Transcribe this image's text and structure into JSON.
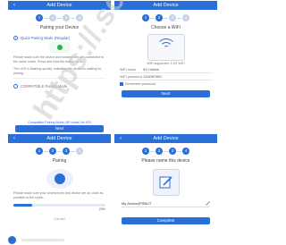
{
  "header_title": "Add Device",
  "steps": [
    "1",
    "2",
    "3",
    "4"
  ],
  "panel1": {
    "subtitle": "Pairing your Device",
    "option1": "Quick Pairing Mode (Regular)",
    "desc1": "Please make sure the device and smartphone are connected to the same router. Press and hold the button for 5s.",
    "desc2": "The LED is flashing quickly, indicating the device is waiting for pairing.",
    "option2": "COMPATIBLE Pairing Mode",
    "link": "Compatible Pairing Mode (AP mode) for iOS",
    "button": "Next"
  },
  "panel2": {
    "subtitle": "Choose a WiFi",
    "caption": "WiFi supported: 2.4G WiFi",
    "wifi_name_label": "WiFi name",
    "wifi_name_value": "5G Hotline",
    "wifi_pw_label": "WiFi password",
    "wifi_pw_value": "1234567891",
    "remember": "Remember password",
    "button": "Next"
  },
  "panel3": {
    "subtitle": "Pairing",
    "note": "Please make sure your smartphone and device are as close as possible to the router.",
    "progress": 0.2,
    "progress_label": "20%",
    "cancel": "Cancel"
  },
  "panel4": {
    "subtitle": "Please name this device",
    "device_name": "My Device(FRBUT",
    "button": "Complete"
  },
  "watermark": "https://.son"
}
